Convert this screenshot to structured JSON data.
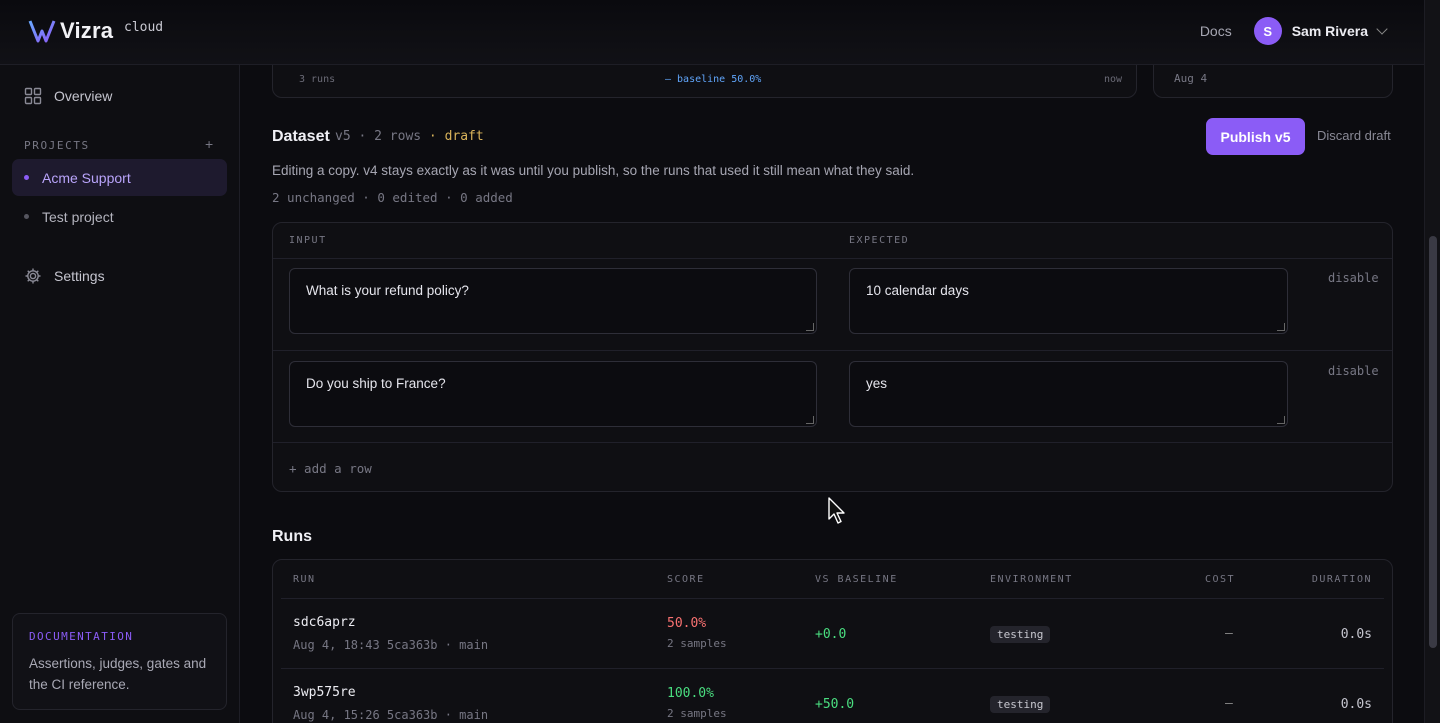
{
  "header": {
    "brand": "Vizra",
    "badge": "cloud",
    "docs_label": "Docs",
    "user_initial": "S",
    "user_name": "Sam Rivera"
  },
  "sidebar": {
    "overview_label": "Overview",
    "projects_label": "PROJECTS",
    "add_project": "+",
    "projects": [
      {
        "label": "Acme Support",
        "active": true
      },
      {
        "label": "Test project",
        "active": false
      }
    ],
    "settings_label": "Settings",
    "doc_card": {
      "title": "DOCUMENTATION",
      "body": "Assertions, judges, gates and the CI reference."
    }
  },
  "stats_strip": {
    "runs_count": "3 runs",
    "baseline_label": "— baseline 50.0%",
    "time_label": "now",
    "date_label": "Aug 4"
  },
  "dataset": {
    "title": "Dataset",
    "meta": "v5 · 2 rows",
    "draft": "· draft",
    "publish_label": "Publish v5",
    "discard_label": "Discard draft",
    "description": "Editing a copy. v4 stays exactly as it was until you publish, so the runs that used it still mean what they said.",
    "counts": "2 unchanged · 0 edited · 0 added",
    "col_input": "INPUT",
    "col_expected": "EXPECTED",
    "rows": [
      {
        "input": "What is your refund policy?",
        "expected": "10 calendar days",
        "action": "disable"
      },
      {
        "input": "Do you ship to France?",
        "expected": "yes",
        "action": "disable"
      }
    ],
    "add_row_label": "+ add a row"
  },
  "runs": {
    "title": "Runs",
    "columns": [
      "RUN",
      "SCORE",
      "VS BASELINE",
      "ENVIRONMENT",
      "COST",
      "DURATION"
    ],
    "rows": [
      {
        "id": "sdc6aprz",
        "sub": "Aug 4, 18:43 5ca363b · main",
        "score": "50.0%",
        "score_color": "#f87171",
        "samples": "2 samples",
        "vs": "+0.0",
        "env": "testing",
        "cost": "—",
        "duration": "0.0s"
      },
      {
        "id": "3wp575re",
        "sub": "Aug 4, 15:26 5ca363b · main",
        "score": "100.0%",
        "score_color": "#4ade80",
        "samples": "2 samples",
        "vs": "+50.0",
        "env": "testing",
        "cost": "—",
        "duration": "0.0s"
      }
    ]
  },
  "colors": {
    "accent": "#8b5cf6",
    "background": "#0c0c10",
    "draft": "#d9b35a",
    "positive": "#4ade80",
    "negative": "#f87171"
  }
}
